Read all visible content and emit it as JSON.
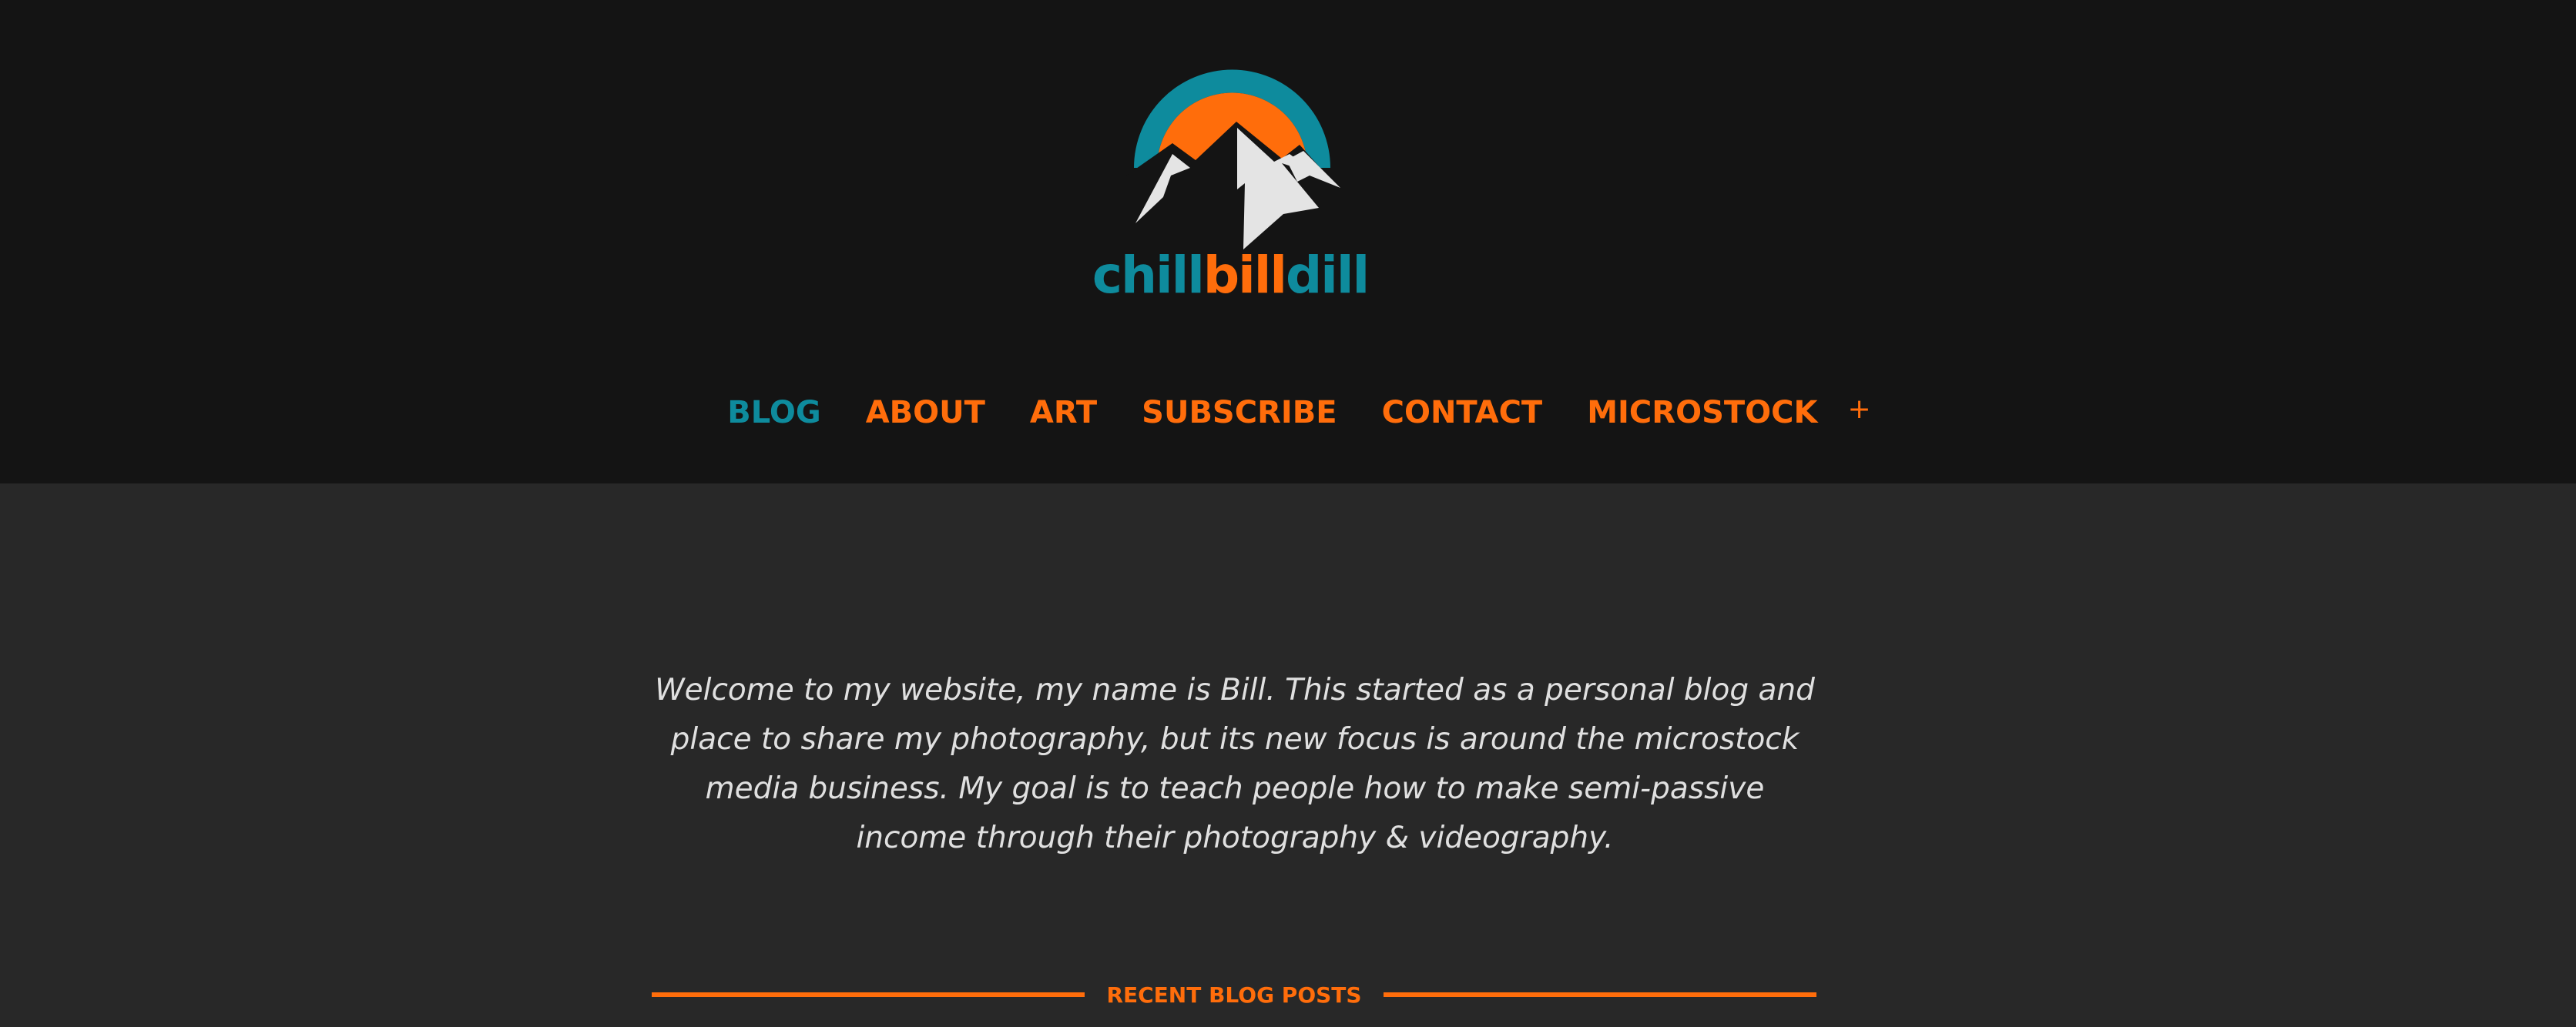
{
  "brand": {
    "name_part1": "chill",
    "name_part2": "bill",
    "name_part3": "dill",
    "colors": {
      "teal": "#0e8b9d",
      "orange": "#ff6d0b",
      "mountain": "#e4e4e4",
      "header_bg": "#141414",
      "body_bg": "#282828"
    }
  },
  "nav": {
    "items": [
      {
        "label": "BLOG",
        "active": true
      },
      {
        "label": "ABOUT",
        "active": false
      },
      {
        "label": "ART",
        "active": false
      },
      {
        "label": "SUBSCRIBE",
        "active": false
      },
      {
        "label": "CONTACT",
        "active": false
      },
      {
        "label": "MICROSTOCK",
        "active": false
      }
    ],
    "expand_symbol": "+"
  },
  "intro": {
    "text": "Welcome to my website, my name is Bill. This started as a personal blog and place to share my photography, but its new focus is around the microstock media business. My goal is to teach people how to make semi-passive income through their photography & videography."
  },
  "recent_posts": {
    "heading": "RECENT BLOG POSTS"
  }
}
